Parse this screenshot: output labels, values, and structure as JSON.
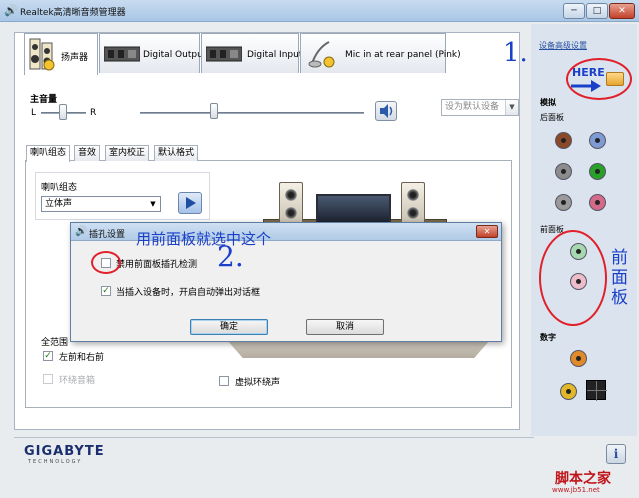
{
  "window": {
    "title": "Realtek高清晰音频管理器",
    "min_label": "─",
    "max_label": "□",
    "close_label": "✕"
  },
  "device_tabs": [
    {
      "label": "扬声器"
    },
    {
      "label": "Digital Output"
    },
    {
      "label": "Digital Input"
    },
    {
      "label": "Mic in at rear panel (Pink)"
    }
  ],
  "volume": {
    "label": "主音量",
    "left_label": "L",
    "right_label": "R"
  },
  "default_device": {
    "label": "设为默认设备"
  },
  "sub_tabs": [
    {
      "label": "喇叭组态"
    },
    {
      "label": "音效"
    },
    {
      "label": "室内校正"
    },
    {
      "label": "默认格式"
    }
  ],
  "speaker_config": {
    "label": "喇叭组态",
    "selected": "立体声"
  },
  "full_range": {
    "label": "全范围",
    "front_label": "左前和右前",
    "surround_label": "环绕音箱"
  },
  "virtual_surround": {
    "label": "虚拟环绕声"
  },
  "sidebar": {
    "advanced_link": "设备高级设置",
    "analog_label": "模拟",
    "rear_panel_label": "后面板",
    "front_panel_label": "前面板",
    "digital_label": "数字"
  },
  "dialog": {
    "title": "插孔设置",
    "close_label": "✕",
    "option1": "禁用前面板插孔检测",
    "option2": "当插入设备时，开启自动弹出对话框",
    "ok_label": "确定",
    "cancel_label": "取消"
  },
  "brand": {
    "name": "GIGABYTE",
    "tagline": "TECHNOLOGY"
  },
  "info_label": "i",
  "annotations": {
    "step1": "1.",
    "step2": "2.",
    "here": "HERE",
    "select_hint": "用前面板就选中这个",
    "front_panel": "前面板"
  },
  "watermark": {
    "line1": "脚本之家",
    "line2": "www.jb51.net"
  },
  "colors": {
    "title_bar": "#b8d0ea",
    "annotation_blue": "#1a3fc8",
    "annotation_red": "#e0202a"
  }
}
